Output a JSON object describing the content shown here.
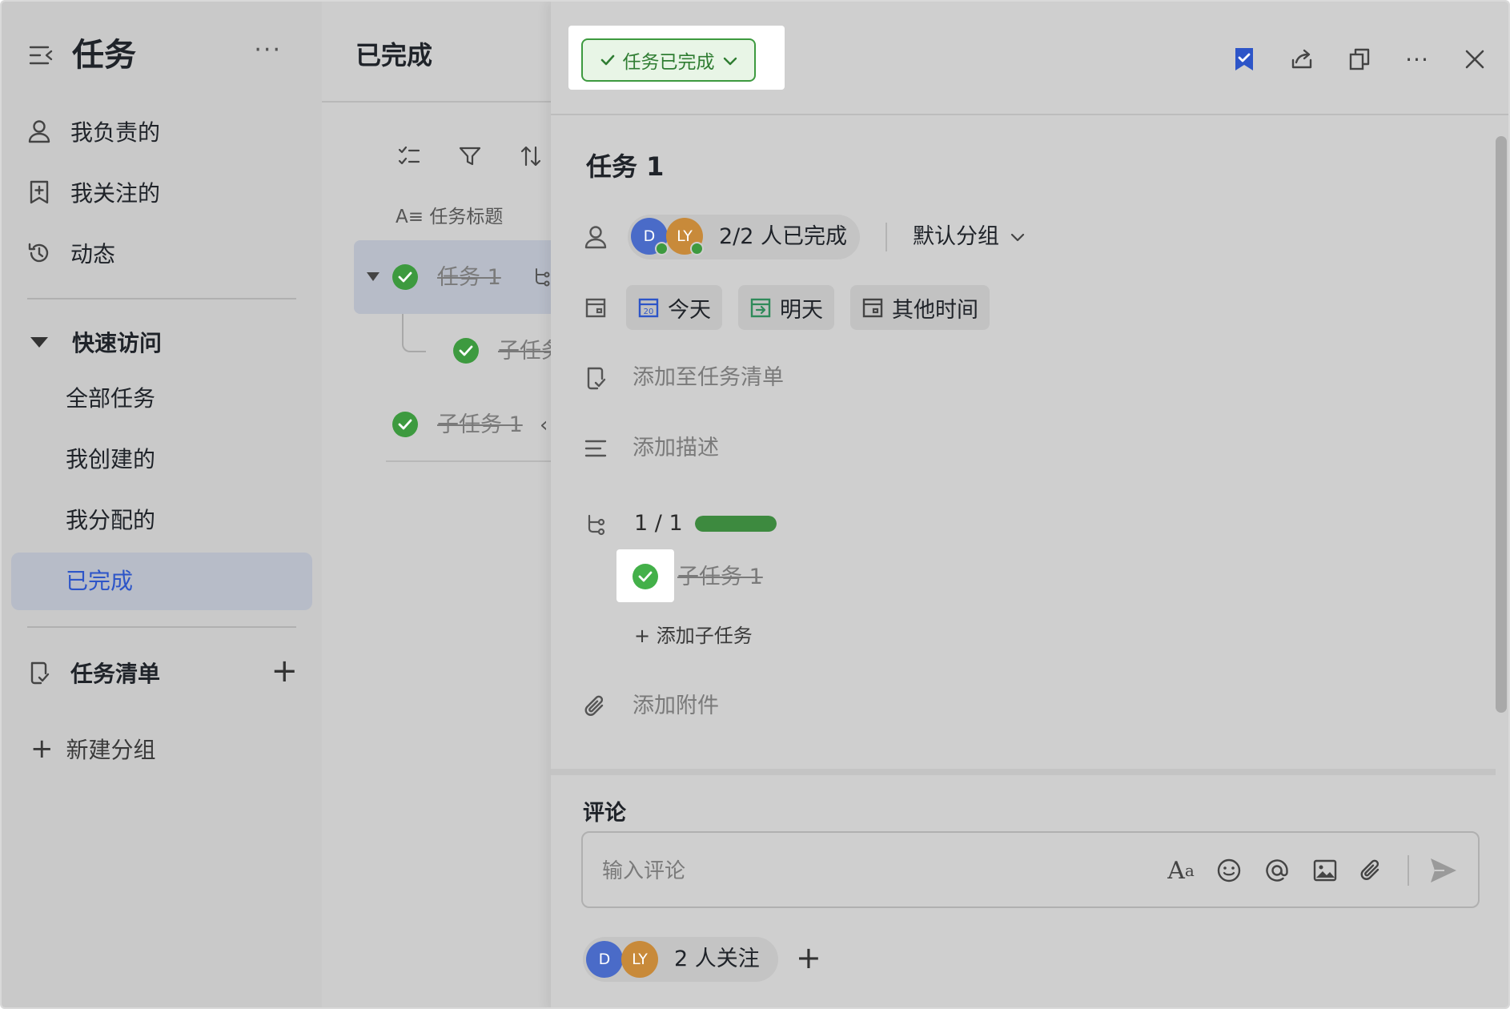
{
  "sidebar": {
    "title": "任务",
    "more": "···",
    "nav": [
      {
        "label": "我负责的",
        "icon": "person-icon"
      },
      {
        "label": "我关注的",
        "icon": "bookmark-add-icon"
      },
      {
        "label": "动态",
        "icon": "history-icon"
      }
    ],
    "quick_access": {
      "label": "快速访问",
      "items": [
        "全部任务",
        "我创建的",
        "我分配的",
        "已完成"
      ],
      "active": "已完成"
    },
    "task_list": {
      "label": "任务清单",
      "add": "+"
    },
    "new_group": {
      "plus": "+",
      "label": "新建分组"
    }
  },
  "middle": {
    "title": "已完成",
    "column_header": "A≡ 任务标题",
    "rows": [
      {
        "label": "任务 1"
      },
      {
        "label": "子任务"
      },
      {
        "label": "子任务 1"
      }
    ]
  },
  "detail": {
    "status": "任务已完成",
    "title": "任务 1",
    "assignees": {
      "avatars": [
        "D",
        "LY"
      ],
      "summary": "2/2 人已完成"
    },
    "group": "默认分组",
    "dates": [
      "今天",
      "明天",
      "其他时间"
    ],
    "add_to_list": "添加至任务清单",
    "add_description": "添加描述",
    "subtasks": {
      "progress_text": "1 / 1",
      "progress_fraction": 1.0,
      "items": [
        "子任务 1"
      ],
      "add": "+ 添加子任务"
    },
    "add_attachment": "添加附件",
    "comment": {
      "label": "评论",
      "placeholder": "输入评论"
    },
    "followers": {
      "avatars": [
        "D",
        "LY"
      ],
      "text": "2 人关注",
      "add": "+"
    }
  },
  "colors": {
    "accent_blue": "#2d55c8",
    "success_green": "#3d9a3f",
    "sidebar_bg": "#c9c9c9",
    "panel_bg": "#cfcfcf",
    "active_bg": "#b7bcc8"
  }
}
